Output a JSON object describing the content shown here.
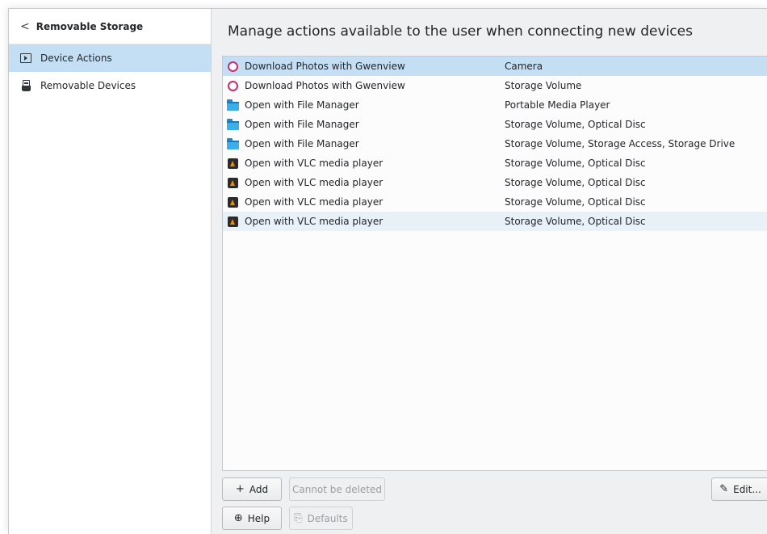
{
  "sidebar": {
    "header": "Removable Storage",
    "items": [
      {
        "label": "Device Actions",
        "icon": "device-actions-icon",
        "selected": true
      },
      {
        "label": "Removable Devices",
        "icon": "usb-drive-icon",
        "selected": false
      }
    ]
  },
  "main": {
    "title": "Manage actions available to the user when connecting new devices"
  },
  "actions": [
    {
      "name": "Download Photos with Gwenview",
      "devices": "Camera",
      "icon": "gwenview-icon"
    },
    {
      "name": "Download Photos with Gwenview",
      "devices": "Storage Volume",
      "icon": "gwenview-icon"
    },
    {
      "name": "Open with File Manager",
      "devices": "Portable Media Player",
      "icon": "folder-icon"
    },
    {
      "name": "Open with File Manager",
      "devices": "Storage Volume, Optical Disc",
      "icon": "folder-icon"
    },
    {
      "name": "Open with File Manager",
      "devices": "Storage Volume, Storage Access, Storage Drive",
      "icon": "folder-icon"
    },
    {
      "name": "Open with VLC media player",
      "devices": "Storage Volume, Optical Disc",
      "icon": "vlc-icon"
    },
    {
      "name": "Open with VLC media player",
      "devices": "Storage Volume, Optical Disc",
      "icon": "vlc-icon"
    },
    {
      "name": "Open with VLC media player",
      "devices": "Storage Volume, Optical Disc",
      "icon": "vlc-icon"
    },
    {
      "name": "Open with VLC media player",
      "devices": "Storage Volume, Optical Disc",
      "icon": "vlc-icon"
    }
  ],
  "buttons": {
    "add": "Add",
    "delete": "Cannot be deleted",
    "edit": "Edit...",
    "help": "Help",
    "defaults": "Defaults"
  },
  "colors": {
    "selection": "#c4dff3",
    "hover": "#e8f1f8",
    "gwenview": "#c42f6e",
    "folder": "#3daee9",
    "vlc": "#f28c00"
  }
}
